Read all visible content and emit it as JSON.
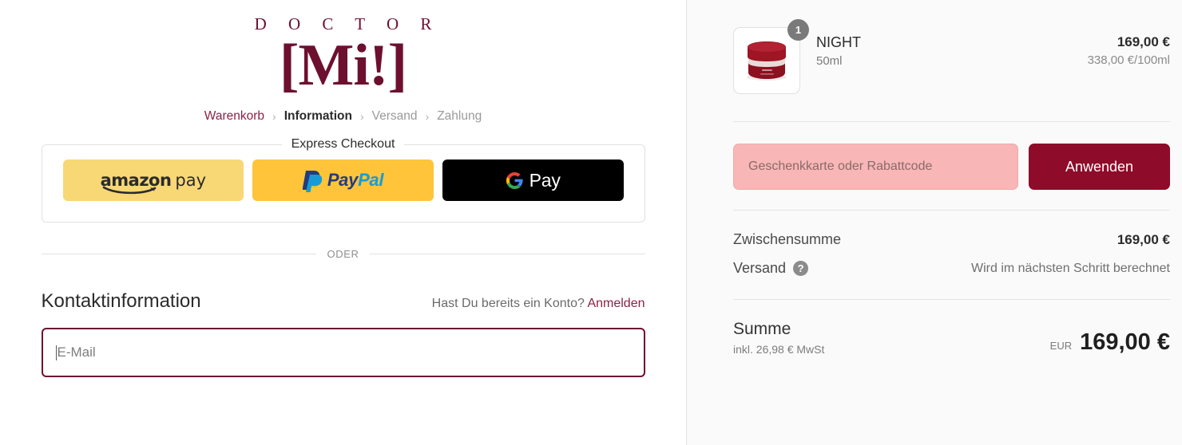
{
  "brand": {
    "name_top": "D O C T O R",
    "name_mark": "[Mi!]",
    "color": "#6d1030"
  },
  "breadcrumb": {
    "items": [
      {
        "label": "Warenkorb",
        "state": "link"
      },
      {
        "label": "Information",
        "state": "current"
      },
      {
        "label": "Versand",
        "state": "muted"
      },
      {
        "label": "Zahlung",
        "state": "muted"
      }
    ],
    "separator": "›"
  },
  "express": {
    "legend": "Express Checkout",
    "buttons": [
      {
        "name": "amazon-pay",
        "word_bold": "amazon",
        "word_light": "pay",
        "bg": "#f8d775"
      },
      {
        "name": "paypal",
        "word_bold": "Pay",
        "word_light": "Pal",
        "bg": "#ffc439"
      },
      {
        "name": "google-pay",
        "word_bold": "G",
        "word_light": "Pay",
        "bg": "#000000"
      }
    ]
  },
  "divider": {
    "or_label": "ODER"
  },
  "contact": {
    "title": "Kontaktinformation",
    "account_question": "Hast Du bereits ein Konto?",
    "login_link": "Anmelden",
    "email_placeholder": "E-Mail",
    "email_value": ""
  },
  "cart": {
    "item": {
      "title": "NIGHT",
      "variant": "50ml",
      "price": "169,00 €",
      "unit_price": "338,00 €/100ml",
      "quantity": "1"
    },
    "discount": {
      "placeholder": "Geschenkkarte oder Rabattcode",
      "value": "",
      "apply_label": "Anwenden"
    },
    "summary": {
      "subtotal_label": "Zwischensumme",
      "subtotal_value": "169,00 €",
      "shipping_label": "Versand",
      "shipping_help_icon": "?",
      "shipping_value": "Wird im nächsten Schritt berechnet"
    },
    "total": {
      "label": "Summe",
      "tax_note": "inkl. 26,98 € MwSt",
      "currency": "EUR",
      "amount": "169,00 €"
    }
  }
}
